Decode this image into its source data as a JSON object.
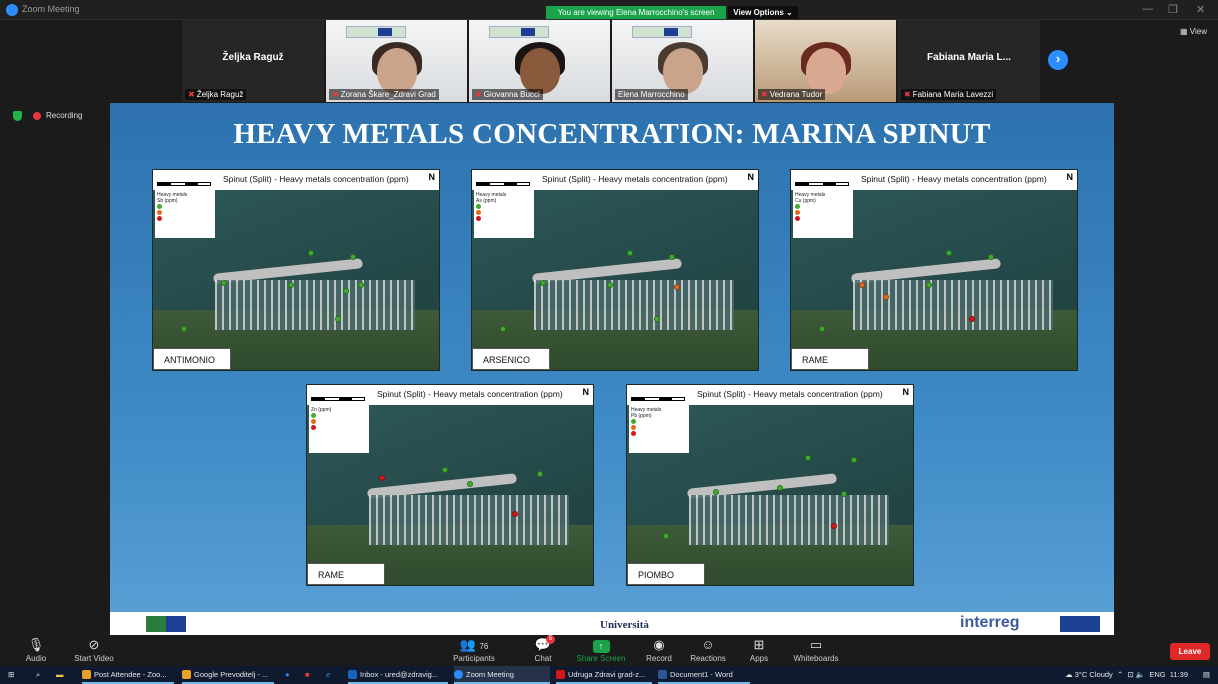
{
  "window": {
    "title": "Zoom Meeting",
    "viewing_banner": "You are viewing Elena Marrocchino's screen",
    "view_options": "View Options",
    "view_button": "View",
    "min_glyph": "—",
    "max_glyph": "❐",
    "close_glyph": "✕"
  },
  "gallery": {
    "tiles": [
      {
        "big_name": "Željka Raguž",
        "label": "Željka Raguž"
      },
      {
        "label": "Zorana Škare_Zdravi Grad"
      },
      {
        "label": "Giovanna Bucci"
      },
      {
        "label": "Elena Marrocchino"
      },
      {
        "label": "Vedrana Tudor"
      },
      {
        "big_name": "Fabiana Maria L...",
        "label": "Fabiana Maria Lavezzi"
      }
    ],
    "next_glyph": "›"
  },
  "recording": {
    "label": "Recording"
  },
  "slide": {
    "title": "HEAVY METALS CONCENTRATION: MARINA SPINUT",
    "map_title": "Spinut (Split) - Heavy metals concentration (ppm)",
    "north": "N",
    "legend_header": "Heavy metals",
    "maps": [
      {
        "caption": "ANTIMONIO",
        "element": "Sb (ppm)"
      },
      {
        "caption": "ARSENICO",
        "element": "As (ppm)"
      },
      {
        "caption": "RAME",
        "element": "Cu (ppm)"
      },
      {
        "caption": "RAME",
        "element": "Zn (ppm)"
      },
      {
        "caption": "PIOMBO",
        "element": "Pb (ppm)"
      }
    ],
    "legend_colors": [
      "#3fae2a",
      "#e06a1e",
      "#d3181a"
    ],
    "footer": {
      "university": "Università",
      "interreg": "interreg"
    }
  },
  "toolbar": {
    "audio": "Audio",
    "start_video": "Start Video",
    "participants": "Participants",
    "participants_count": "76",
    "chat": "Chat",
    "chat_badge": "5",
    "share_screen": "Share Screen",
    "record": "Record",
    "reactions": "Reactions",
    "apps": "Apps",
    "whiteboards": "Whiteboards",
    "leave": "Leave"
  },
  "taskbar": {
    "items": [
      "Post Attendee - Zoo...",
      "Google Prevoditelj - ...",
      "Inbox - ured@zdravig...",
      "Zoom Meeting",
      "Udruga Zdravi grad-z...",
      "Document1 - Word"
    ],
    "weather": "3°C Cloudy",
    "lang": "ENG",
    "time": "11:39"
  }
}
